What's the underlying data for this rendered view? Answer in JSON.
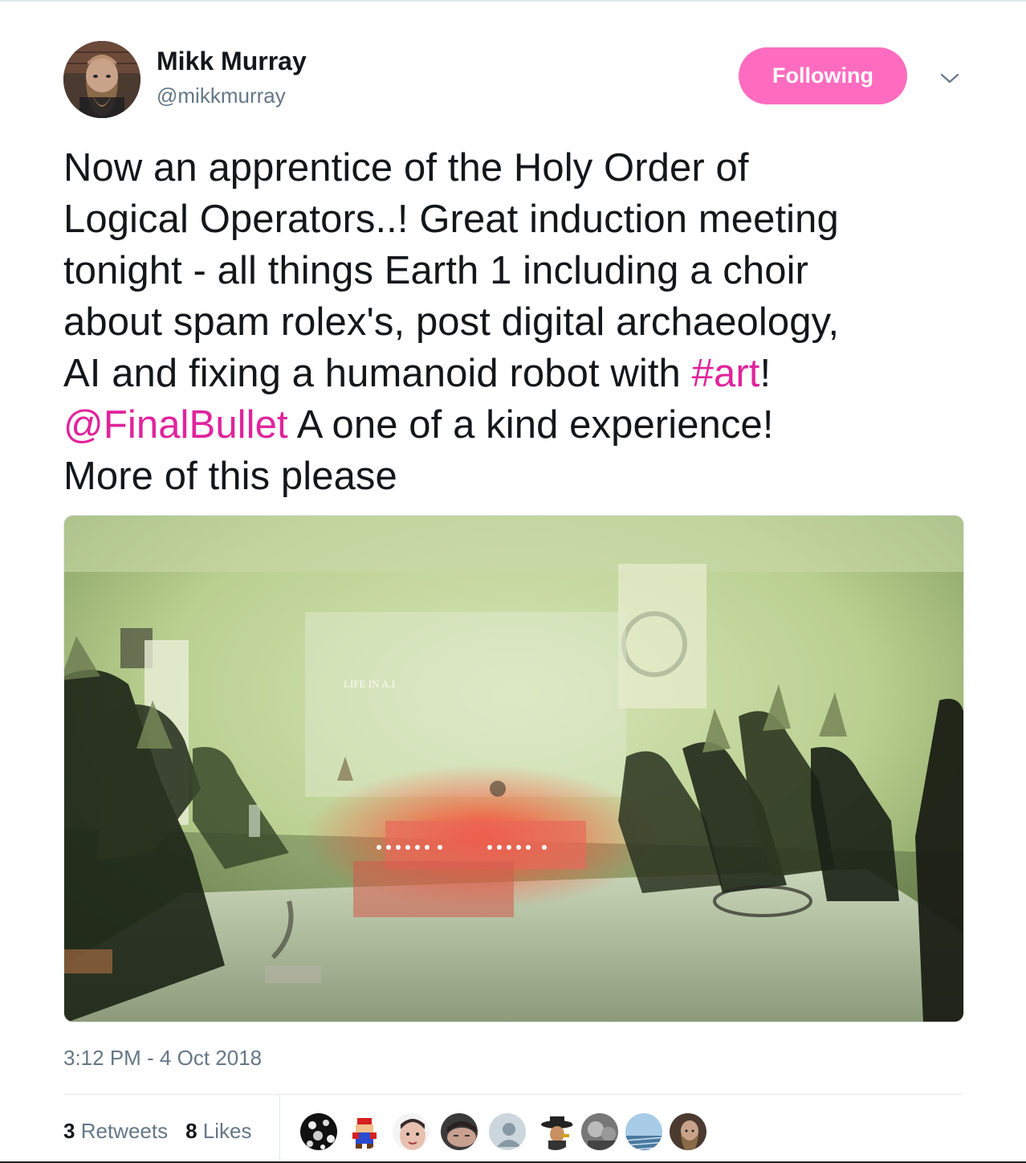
{
  "author": {
    "name": "Mikk Murray",
    "handle": "@mikkmurray",
    "avatar": "bearded-man-avatar"
  },
  "follow_button": {
    "label": "Following",
    "color": "#ff6cbf"
  },
  "menu": {
    "icon": "chevron-down-icon"
  },
  "tweet": {
    "lines": [
      "Now an apprentice of the Holy Order of",
      "Logical Operators..! Great induction meeting",
      "tonight - all things Earth 1 including a choir",
      "about spam rolex's, post digital archaeology,"
    ],
    "line5_prefix": "AI and fixing a humanoid robot with ",
    "hashtag": "#art",
    "line5_suffix": "!",
    "mention": "@FinalBullet",
    "line6_suffix": " A one of a kind experience!",
    "line7": "More of this please",
    "link_color": "#e0249c"
  },
  "media": {
    "projection_text": "LIFE IN A.I."
  },
  "timestamp": "3:12 PM - 4 Oct 2018",
  "stats": {
    "retweets_count": "3",
    "retweets_label": "Retweets",
    "likes_count": "8",
    "likes_label": "Likes"
  },
  "likers": [
    "pattern-avatar",
    "mario-avatar",
    "face-avatar",
    "sleeping-face-avatar",
    "default-profile-avatar",
    "hat-figure-avatar",
    "bw-photo-avatar",
    "landscape-avatar",
    "bearded-man-avatar"
  ]
}
